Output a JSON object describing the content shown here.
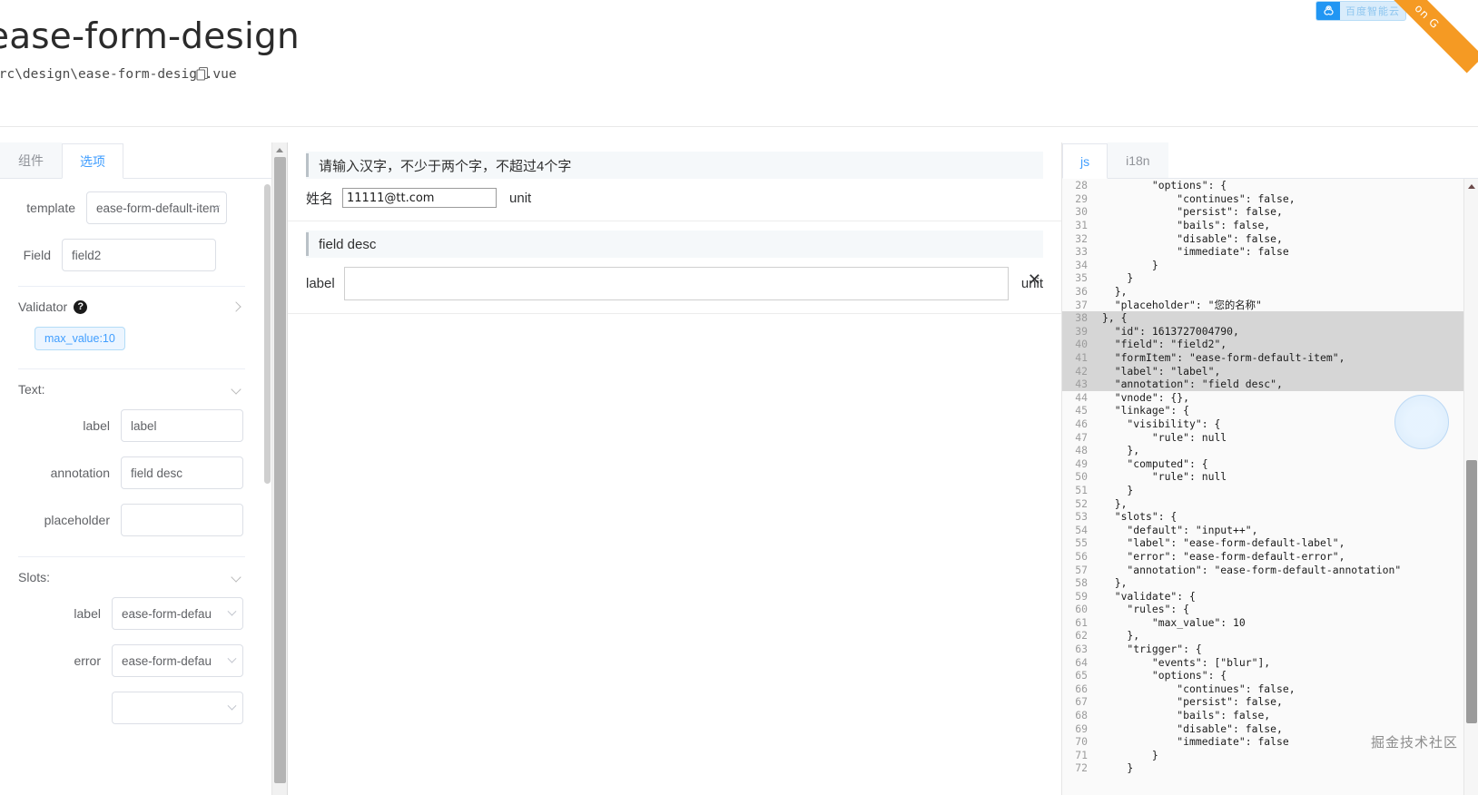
{
  "header": {
    "cut_title": "g",
    "title": "ease-form-design",
    "path": "src\\design\\ease-form-design.vue",
    "copy_icon": "copy-icon"
  },
  "top_badge": {
    "logo_icon": "cloud-trio-logo-icon",
    "text": "百度智能云",
    "ribbon_text": "on G"
  },
  "left_panel": {
    "tabs": [
      {
        "label": "组件",
        "active": false
      },
      {
        "label": "选项",
        "active": true
      }
    ],
    "template_row": {
      "label": "template",
      "value": "ease-form-default-item"
    },
    "field_row": {
      "label": "Field",
      "value": "field2"
    },
    "validator": {
      "label": "Validator",
      "help_icon": "question-mark-icon",
      "expand_icon": "chevron-right-icon"
    },
    "validator_tags": [
      "max_value:10"
    ],
    "text_section": {
      "label": "Text:",
      "collapse_icon": "chevron-down-icon"
    },
    "text_rows": [
      {
        "label": "label",
        "value": "label",
        "placeholder": ""
      },
      {
        "label": "annotation",
        "value": "field desc",
        "placeholder": ""
      },
      {
        "label": "placeholder",
        "value": "",
        "placeholder": ""
      }
    ],
    "slots_section": {
      "label": "Slots:",
      "collapse_icon": "chevron-down-icon"
    },
    "slot_rows": [
      {
        "label": "label",
        "value": "ease-form-defau"
      },
      {
        "label": "error",
        "value": "ease-form-defau"
      }
    ]
  },
  "center_panel": {
    "blocks": [
      {
        "annotation": "请输入汉字，不少于两个字，不超过4个字",
        "label": "姓名",
        "value": "11111@tt.com",
        "unit": "unit",
        "input_kind": "small",
        "closable": false
      },
      {
        "annotation": "field desc",
        "label": "label",
        "value": "",
        "unit": "unit",
        "input_kind": "big",
        "closable": true,
        "close_icon": "close-icon"
      }
    ]
  },
  "right_panel": {
    "tabs": [
      {
        "label": "js",
        "active": true
      },
      {
        "label": "i18n",
        "active": false
      }
    ],
    "watermark": "掘金技术社区",
    "first_line_no": 28,
    "highlight_from": 38,
    "highlight_to": 43,
    "code_lines": [
      "        \"options\": {",
      "            \"continues\": false,",
      "            \"persist\": false,",
      "            \"bails\": false,",
      "            \"disable\": false,",
      "            \"immediate\": false",
      "        }",
      "    }",
      "  },",
      "  \"placeholder\": \"您的名称\"",
      "}, {",
      "  \"id\": 1613727004790,",
      "  \"field\": \"field2\",",
      "  \"formItem\": \"ease-form-default-item\",",
      "  \"label\": \"label\",",
      "  \"annotation\": \"field desc\",",
      "  \"vnode\": {},",
      "  \"linkage\": {",
      "    \"visibility\": {",
      "        \"rule\": null",
      "    },",
      "    \"computed\": {",
      "        \"rule\": null",
      "    }",
      "  },",
      "  \"slots\": {",
      "    \"default\": \"input++\",",
      "    \"label\": \"ease-form-default-label\",",
      "    \"error\": \"ease-form-default-error\",",
      "    \"annotation\": \"ease-form-default-annotation\"",
      "  },",
      "  \"validate\": {",
      "    \"rules\": {",
      "        \"max_value\": 10",
      "    },",
      "    \"trigger\": {",
      "        \"events\": [\"blur\"],",
      "        \"options\": {",
      "            \"continues\": false,",
      "            \"persist\": false,",
      "            \"bails\": false,",
      "            \"disable\": false,",
      "            \"immediate\": false",
      "        }",
      "    }"
    ]
  },
  "colors": {
    "accent": "#409eff",
    "badge_blue": "#2196f3",
    "ribbon_orange": "#f59a23",
    "highlight_gray": "#d6d6d6"
  }
}
